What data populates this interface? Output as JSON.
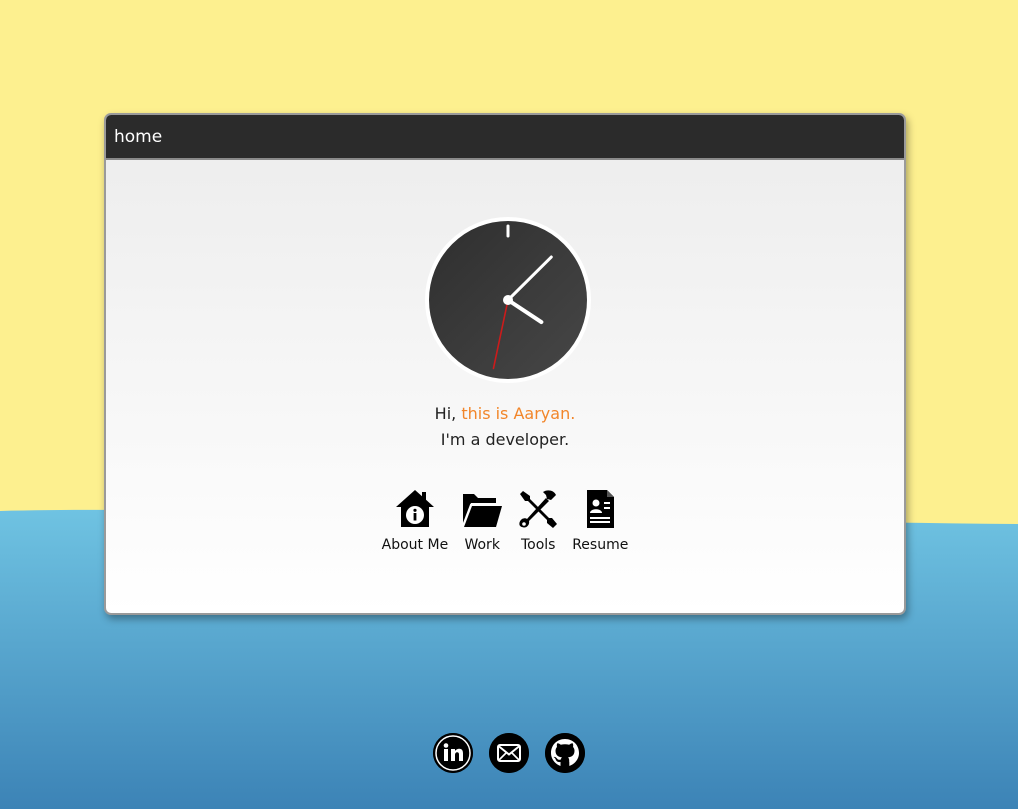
{
  "window": {
    "title": "home"
  },
  "clock": {
    "hour": 4,
    "minute": 7,
    "second": 32
  },
  "greeting": {
    "hi": "Hi, ",
    "name": "this is Aaryan.",
    "role": "I'm a developer."
  },
  "nav": [
    {
      "label": "About Me",
      "icon": "house-info-icon"
    },
    {
      "label": "Work",
      "icon": "folder-icon"
    },
    {
      "label": "Tools",
      "icon": "tools-icon"
    },
    {
      "label": "Resume",
      "icon": "resume-icon"
    }
  ],
  "socials": [
    {
      "icon": "linkedin-icon"
    },
    {
      "icon": "mail-icon"
    },
    {
      "icon": "github-icon"
    }
  ],
  "colors": {
    "sky": "#fdf08f",
    "sea_top": "#6fc3e2",
    "sea_bottom": "#3c83b6",
    "accent": "#f2862a",
    "titlebar": "#2b2b2b",
    "clock_face": "#353535",
    "second_hand": "#cc1b1b"
  }
}
